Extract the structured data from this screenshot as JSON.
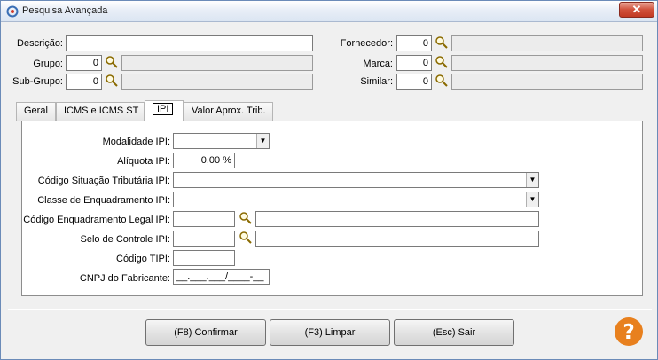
{
  "window": {
    "title": "Pesquisa Avançada",
    "close_glyph": "✕"
  },
  "top": {
    "descricao_label": "Descrição:",
    "descricao_value": "",
    "grupo_label": "Grupo:",
    "grupo_code": "0",
    "grupo_desc": "",
    "subgrupo_label": "Sub-Grupo:",
    "subgrupo_code": "0",
    "subgrupo_desc": "",
    "fornecedor_label": "Fornecedor:",
    "fornecedor_code": "0",
    "fornecedor_desc": "",
    "marca_label": "Marca:",
    "marca_code": "0",
    "marca_desc": "",
    "similar_label": "Similar:",
    "similar_code": "0",
    "similar_desc": ""
  },
  "tabs": [
    {
      "label": "Geral"
    },
    {
      "label": "ICMS e ICMS ST"
    },
    {
      "label": "IPI",
      "active": true
    },
    {
      "label": "Valor Aprox. Trib."
    }
  ],
  "ipi": {
    "modalidade_label": "Modalidade IPI:",
    "modalidade_value": "",
    "aliquota_label": "Alíquota IPI:",
    "aliquota_value": "0,00 %",
    "cst_label": "Código Situação Tributária IPI:",
    "cst_value": "",
    "classe_label": "Classe de Enquadramento IPI:",
    "classe_value": "",
    "enq_label": "Código Enquadramento Legal IPI:",
    "enq_code": "",
    "enq_desc": "",
    "selo_label": "Selo de Controle IPI:",
    "selo_code": "",
    "selo_desc": "",
    "tipi_label": "Código TIPI:",
    "tipi_value": "",
    "cnpj_label": "CNPJ do Fabricante:",
    "cnpj_value": "__.___.___/____-__"
  },
  "buttons": {
    "confirm": "(F8) Confirmar",
    "clear": "(F3) Limpar",
    "exit": "(Esc) Sair"
  },
  "icons": {
    "search": "magnifier-icon",
    "dropdown": "▼",
    "help": "?"
  },
  "colors": {
    "help_orange": "#e8801e",
    "tab_active": "#ffffff"
  }
}
